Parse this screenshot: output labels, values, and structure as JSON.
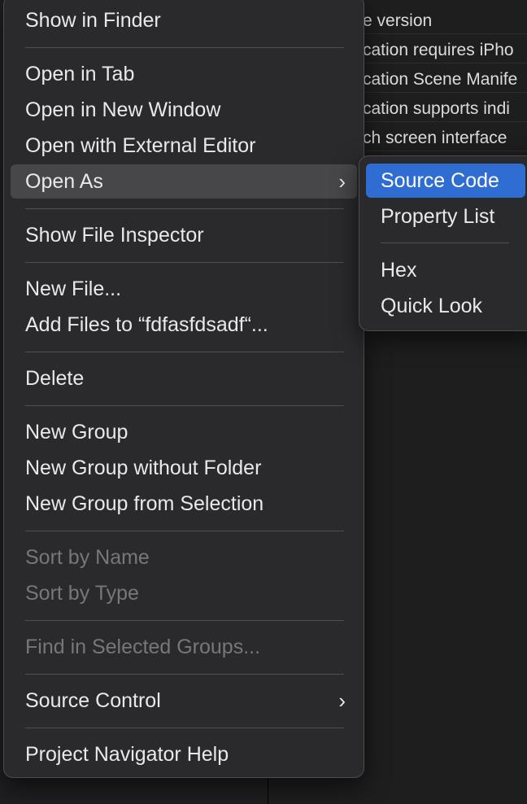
{
  "background": {
    "plist_rows": [
      "e version",
      "cation requires iPho",
      "cation Scene Manife",
      "cation supports indi",
      "ch screen interface"
    ]
  },
  "menu": {
    "items": [
      {
        "label": "Show in Finder"
      },
      {
        "label": "Open in Tab"
      },
      {
        "label": "Open in New Window"
      },
      {
        "label": "Open with External Editor"
      },
      {
        "label": "Open As",
        "chevron": "›"
      },
      {
        "label": "Show File Inspector"
      },
      {
        "label": "New File..."
      },
      {
        "label": "Add Files to “fdfasfdsadf“..."
      },
      {
        "label": "Delete"
      },
      {
        "label": "New Group"
      },
      {
        "label": "New Group without Folder"
      },
      {
        "label": "New Group from Selection"
      },
      {
        "label": "Sort by Name"
      },
      {
        "label": "Sort by Type"
      },
      {
        "label": "Find in Selected Groups..."
      },
      {
        "label": "Source Control",
        "chevron": "›"
      },
      {
        "label": "Project Navigator Help"
      }
    ]
  },
  "submenu": {
    "items": [
      {
        "label": "Source Code"
      },
      {
        "label": "Property List"
      },
      {
        "label": "Hex"
      },
      {
        "label": "Quick Look"
      }
    ]
  },
  "colors": {
    "menu_bg": "#2a2a2c",
    "highlight": "#47474a",
    "selection": "#2f6dd2",
    "disabled_text": "#77777a"
  }
}
